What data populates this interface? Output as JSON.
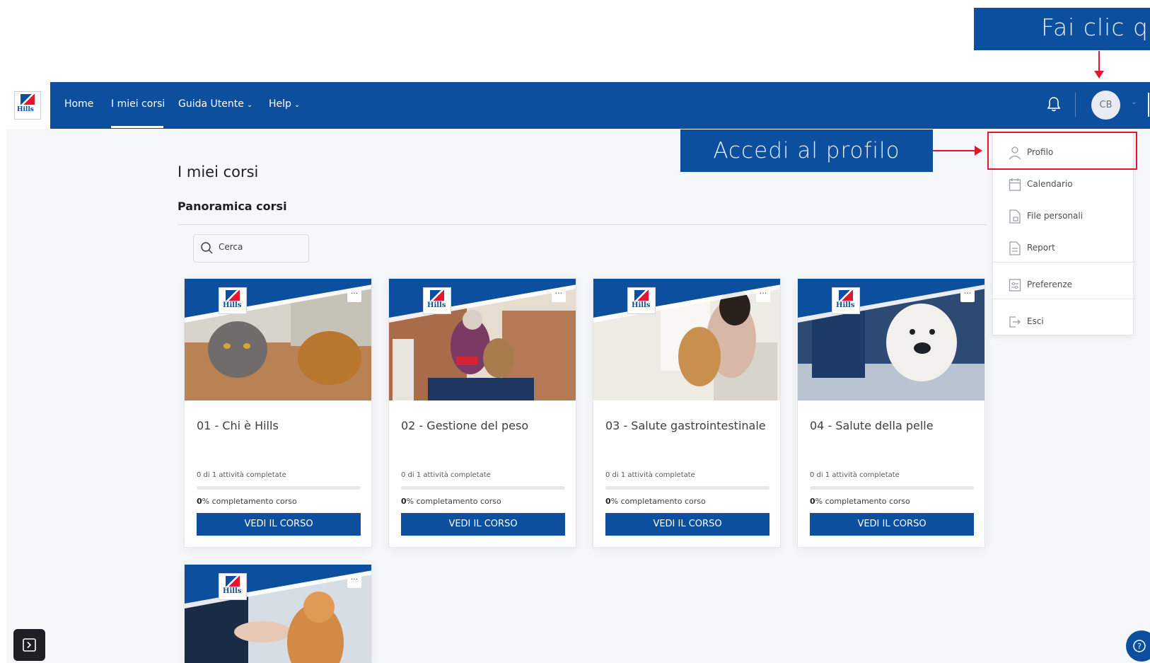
{
  "annotations": {
    "top_banner": "Fai clic qu",
    "profile_callout": "Accedi al profilo"
  },
  "navbar": {
    "logo_text": "Hills",
    "links": {
      "home": "Home",
      "my_courses": "I miei corsi",
      "user_guide": "Guida Utente",
      "help": "Help"
    },
    "avatar_initials": "CB"
  },
  "page": {
    "title": "I miei corsi",
    "section_title": "Panoramica corsi",
    "search": {
      "placeholder": "Cerca",
      "value": ""
    }
  },
  "user_menu": {
    "items": [
      {
        "label": "Profilo",
        "icon": "user-icon"
      },
      {
        "label": "Calendario",
        "icon": "calendar-icon"
      },
      {
        "label": "File personali",
        "icon": "files-icon"
      },
      {
        "label": "Report",
        "icon": "report-icon"
      },
      {
        "label": "Preferenze",
        "icon": "preferences-icon"
      },
      {
        "label": "Esci",
        "icon": "logout-icon"
      }
    ]
  },
  "courses": [
    {
      "title": "01 - Chi è Hills",
      "activities": "0 di 1 attività completate",
      "percent": "0",
      "percent_suffix": "% completamento corso",
      "progress": 0,
      "button": "VEDI IL CORSO",
      "image": "cat-and-dog-at-table"
    },
    {
      "title": "02 - Gestione del peso",
      "activities": "0 di 1 attività completate",
      "percent": "0",
      "percent_suffix": "% completamento corso",
      "progress": 0,
      "button": "VEDI IL CORSO",
      "image": "woman-feeding-dog-kitchen"
    },
    {
      "title": "03 - Salute gastrointestinale",
      "activities": "0 di 1 attività completate",
      "percent": "0",
      "percent_suffix": "% completamento corso",
      "progress": 0,
      "button": "VEDI IL CORSO",
      "image": "woman-with-dog-by-window"
    },
    {
      "title": "04 - Salute della pelle",
      "activities": "0 di 1 attività completate",
      "percent": "0",
      "percent_suffix": "% completamento corso",
      "progress": 0,
      "button": "VEDI IL CORSO",
      "image": "white-terrier-at-vet"
    },
    {
      "title": "",
      "activities": "",
      "percent": "",
      "percent_suffix": "",
      "progress": 0,
      "button": "",
      "image": "cat-high-five"
    }
  ],
  "colors": {
    "brand_blue": "#0d4f9f",
    "annotation_red": "#e3162e"
  }
}
